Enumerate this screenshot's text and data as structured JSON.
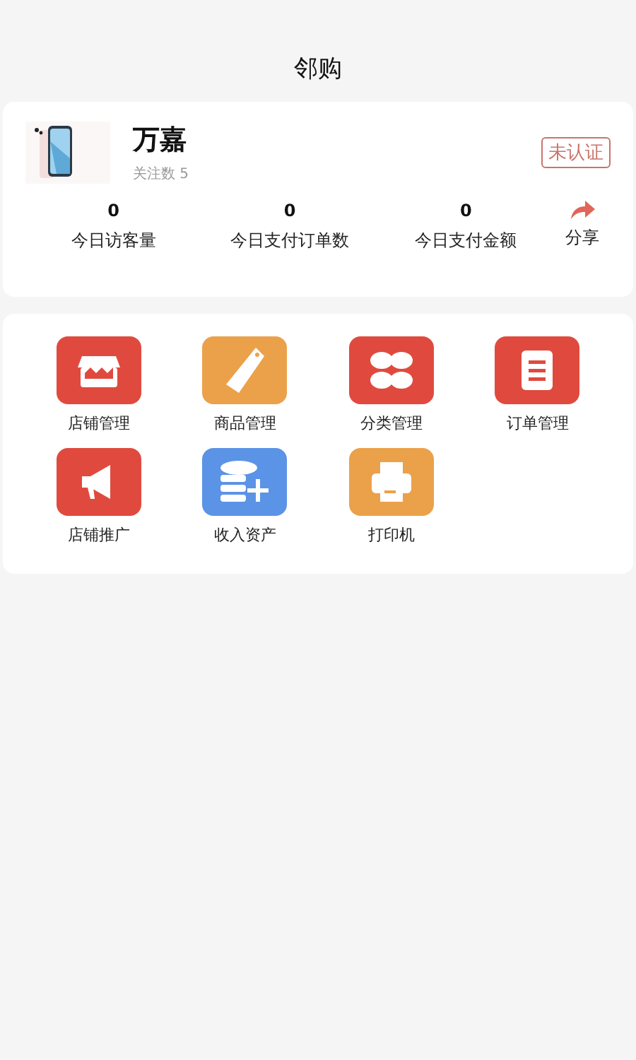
{
  "header": {
    "title": "邻购"
  },
  "shop": {
    "name": "万嘉",
    "followers": "关注数 5",
    "badge": "未认证"
  },
  "stats": [
    {
      "value": "0",
      "label": "今日访客量"
    },
    {
      "value": "0",
      "label": "今日支付订单数"
    },
    {
      "value": "0",
      "label": "今日支付金额"
    }
  ],
  "share": {
    "label": "分享"
  },
  "menu": [
    {
      "label": "店铺管理",
      "kind": "store",
      "color": "#e04a3e"
    },
    {
      "label": "商品管理",
      "kind": "tag",
      "color": "#eba14a"
    },
    {
      "label": "分类管理",
      "kind": "grid",
      "color": "#e04a3e"
    },
    {
      "label": "订单管理",
      "kind": "clipboard",
      "color": "#e04a3e"
    },
    {
      "label": "店铺推广",
      "kind": "megaphone",
      "color": "#e04a3e"
    },
    {
      "label": "收入资产",
      "kind": "coins",
      "color": "#5b93e6"
    },
    {
      "label": "打印机",
      "kind": "printer",
      "color": "#eba14a"
    }
  ]
}
